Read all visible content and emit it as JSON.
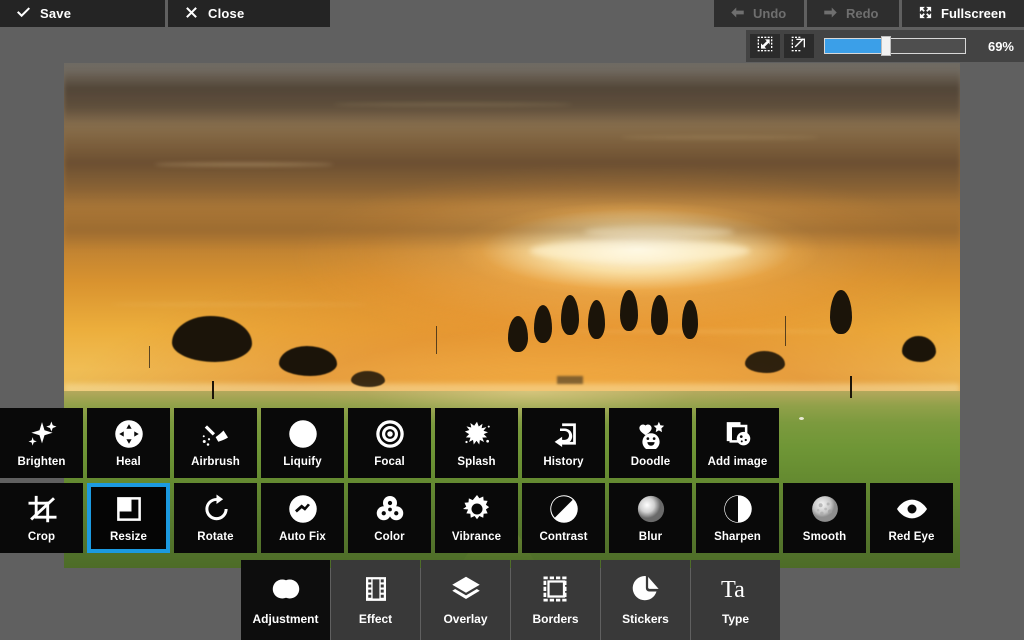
{
  "topbar": {
    "save_label": "Save",
    "close_label": "Close",
    "undo_label": "Undo",
    "redo_label": "Redo",
    "fullscreen_label": "Fullscreen",
    "undo_state": "disabled",
    "redo_state": "disabled",
    "fullscreen_state": "enabled"
  },
  "zoombar": {
    "fit_icon": "fit-to-screen-icon",
    "actual_icon": "actual-size-icon",
    "zoom_percent": "69%",
    "zoom_value": 69,
    "slider_min": 0,
    "slider_max": 100
  },
  "canvas": {
    "photo_description": "Golden sunset over a green meadow with tree silhouettes, a row of poplars and grazing sheep",
    "accent_color": "#1c9ae0",
    "background_color": "#606060"
  },
  "toolrow1": [
    {
      "label": "Brighten",
      "icon": "sparkles-icon",
      "selected": false
    },
    {
      "label": "Heal",
      "icon": "heal-target-icon",
      "selected": false
    },
    {
      "label": "Airbrush",
      "icon": "airbrush-icon",
      "selected": false
    },
    {
      "label": "Liquify",
      "icon": "liquify-wave-icon",
      "selected": false
    },
    {
      "label": "Focal",
      "icon": "focal-rings-icon",
      "selected": false
    },
    {
      "label": "Splash",
      "icon": "splash-icon",
      "selected": false
    },
    {
      "label": "History",
      "icon": "history-undo-icon",
      "selected": false
    },
    {
      "label": "Doodle",
      "icon": "doodle-icon",
      "selected": false
    },
    {
      "label": "Add image",
      "icon": "add-image-icon",
      "selected": false
    }
  ],
  "toolrow2": [
    {
      "label": "Crop",
      "icon": "crop-icon",
      "selected": false
    },
    {
      "label": "Resize",
      "icon": "resize-icon",
      "selected": true
    },
    {
      "label": "Rotate",
      "icon": "rotate-icon",
      "selected": false
    },
    {
      "label": "Auto Fix",
      "icon": "auto-fix-icon",
      "selected": false
    },
    {
      "label": "Color",
      "icon": "color-circles-icon",
      "selected": false
    },
    {
      "label": "Vibrance",
      "icon": "vibrance-sun-icon",
      "selected": false
    },
    {
      "label": "Contrast",
      "icon": "contrast-icon",
      "selected": false
    },
    {
      "label": "Blur",
      "icon": "blur-icon",
      "selected": false
    },
    {
      "label": "Sharpen",
      "icon": "sharpen-icon",
      "selected": false
    },
    {
      "label": "Smooth",
      "icon": "smooth-icon",
      "selected": false
    },
    {
      "label": "Red Eye",
      "icon": "red-eye-icon",
      "selected": false
    }
  ],
  "tabs": [
    {
      "label": "Adjustment",
      "icon": "adjustment-icon",
      "active": true
    },
    {
      "label": "Effect",
      "icon": "film-strip-icon",
      "active": false
    },
    {
      "label": "Overlay",
      "icon": "layers-icon",
      "active": false
    },
    {
      "label": "Borders",
      "icon": "border-frame-icon",
      "active": false
    },
    {
      "label": "Stickers",
      "icon": "sticker-icon",
      "active": false
    },
    {
      "label": "Type",
      "icon": "type-ta-icon",
      "active": false
    }
  ]
}
